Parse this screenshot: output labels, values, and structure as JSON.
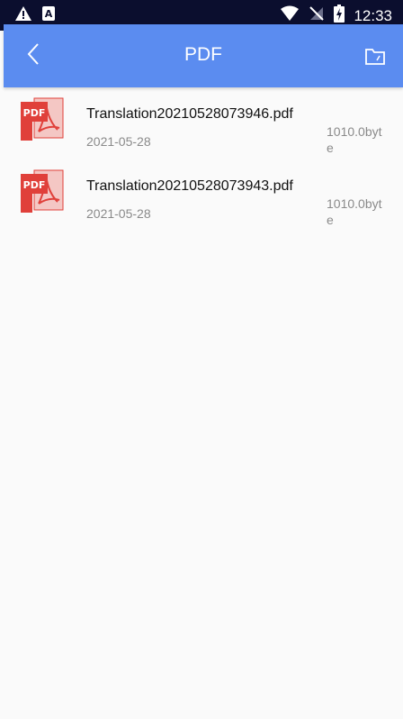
{
  "status_bar": {
    "time": "12:33",
    "icons_left": [
      "warning-icon",
      "a-icon"
    ],
    "icons_right": [
      "wifi-icon",
      "no-signal-icon",
      "battery-charging-icon"
    ]
  },
  "header": {
    "title": "PDF",
    "back_icon": "chevron-left-icon",
    "action_icon": "folder-icon",
    "background": "#5b8cf0"
  },
  "files": [
    {
      "name": "Translation20210528073946.pdf",
      "date": "2021-05-28",
      "size": "1010.0byte",
      "icon": "pdf-file-icon"
    },
    {
      "name": "Translation20210528073943.pdf",
      "date": "2021-05-28",
      "size": "1010.0byte",
      "icon": "pdf-file-icon"
    }
  ],
  "colors": {
    "status_bar": "#0b0e2e",
    "accent": "#5b8cf0",
    "pdf_red": "#e0403a",
    "background": "#fafafa"
  }
}
